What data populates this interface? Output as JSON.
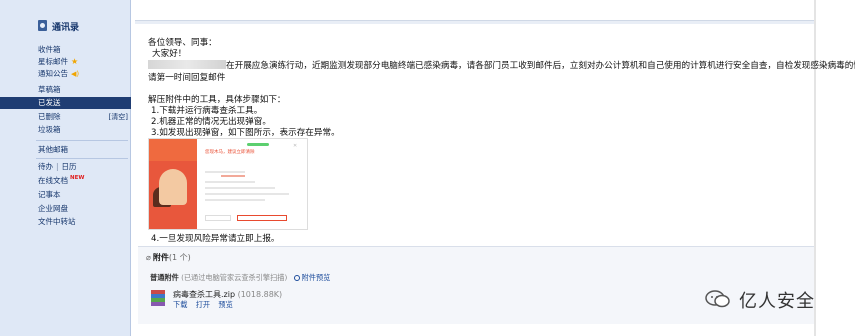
{
  "sidebar": {
    "title": "通讯录",
    "items": [
      {
        "label": "收件箱"
      },
      {
        "label": "星标邮件"
      },
      {
        "label": "通知公告"
      },
      {
        "label": "草稿箱"
      },
      {
        "label": "已发送"
      },
      {
        "label": "已删除",
        "extra": "[清空]"
      },
      {
        "label": "垃圾箱"
      },
      {
        "label": "其他邮箱"
      },
      {
        "label": "待办",
        "extra": "日历"
      },
      {
        "label": "在线文档",
        "badge": "NEW"
      },
      {
        "label": "记事本"
      },
      {
        "label": "企业网盘"
      },
      {
        "label": "文件中转站"
      }
    ],
    "active_index": 4
  },
  "mail": {
    "greeting": "各位领导、同事：",
    "hello": "大家好！",
    "para1_a": "在开展应急演练行动，近期监测发现部分电脑终端已感染病毒，请各部门员工收到邮件后，立刻对办公计算机和自己使用的计算机进行安全自查，自检发现感染病毒的情况",
    "para1_b": "请第一时间回复邮件",
    "steps_intro": "解压附件中的工具，具体步骤如下：",
    "step1": "1.下载并运行病毒查杀工具。",
    "step2": "2.机器正常的情况无出现弹窗。",
    "step3": "3.如发现出现弹窗，如下图所示，表示存在异常。",
    "step4": "4.一旦发现风险异常请立即上报。",
    "popup_title": "您现木马，建议立即清除"
  },
  "attachments": {
    "header": "附件",
    "count": "(1 个)",
    "type_label": "普通附件",
    "scan_note": "(已通过电脑管家云查杀引擎扫描)",
    "preview_label": "附件预览",
    "file_name": "病毒查杀工具.zip",
    "file_size": "(1018.88K)",
    "actions": [
      "下载",
      "打开",
      "预览"
    ]
  },
  "watermark": {
    "text": "亿人安全"
  },
  "colors": {
    "sidebar_bg": "#dfe8f6",
    "active_bg": "#1f3d73",
    "link": "#1b4b9b",
    "popup_red": "#e8573c"
  }
}
